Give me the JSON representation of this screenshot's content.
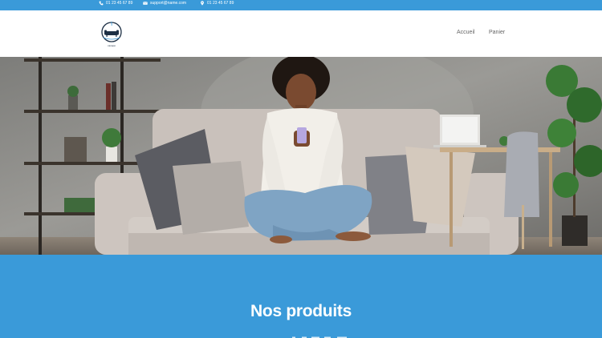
{
  "topbar": {
    "phone_1": "01 23 45 67 89",
    "email": "support@name.com",
    "phone_2": "01 23 45 67 89",
    "icons": [
      "phone-icon",
      "mail-icon",
      "location-pin-icon"
    ]
  },
  "header": {
    "logo_text": "canapé",
    "nav": [
      {
        "label": "Accueil"
      },
      {
        "label": "Panier"
      }
    ]
  },
  "products": {
    "title": "Nos produits"
  },
  "colors": {
    "accent": "#3a9ad9",
    "text_on_accent": "#ffffff",
    "nav_text": "#666666"
  }
}
